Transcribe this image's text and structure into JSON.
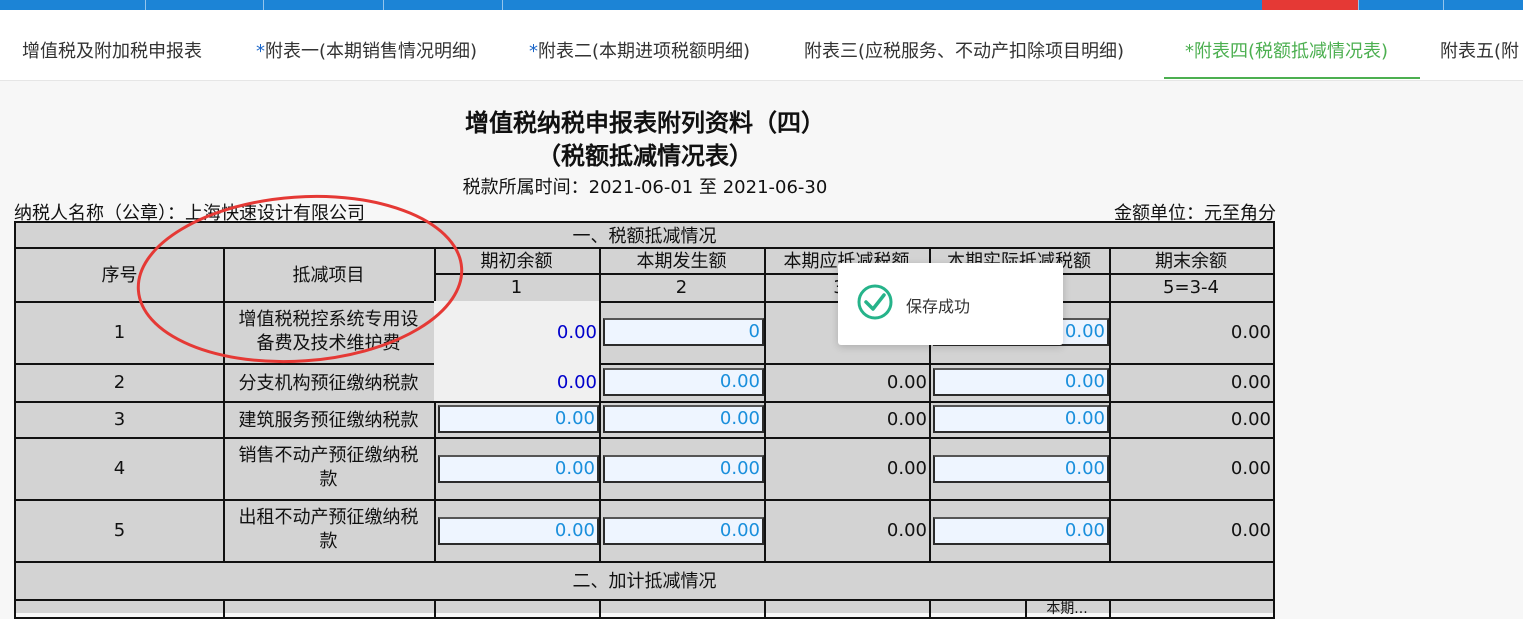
{
  "header_tabs": [
    {
      "label": "增值税及附加税申报表",
      "star": ""
    },
    {
      "label": "附表一(本期销售情况明细)",
      "star": "*"
    },
    {
      "label": "附表二(本期进项税额明细)",
      "star": "*"
    },
    {
      "label": "附表三(应税服务、不动产扣除项目明细)",
      "star": ""
    },
    {
      "label": "附表四(税额抵减情况表)",
      "star": "*"
    },
    {
      "label": "附表五(附",
      "star": ""
    }
  ],
  "form": {
    "title_line1": "增值税纳税申报表附列资料（四）",
    "title_line2": "（税额抵减情况表）",
    "period": "税款所属时间：2021-06-01 至 2021-06-30",
    "taxpayer": "纳税人名称（公章）：上海快速设计有限公司",
    "unit": "金额单位：元至角分",
    "section1": "一、税额抵减情况",
    "section2": "二、加计抵减情况",
    "col_seq": "序号",
    "col_item": "抵减项目",
    "col_begin": "期初余额",
    "col_current": "本期发生额",
    "col_deductible": "本期应抵减税额",
    "col_actual": "本期实际抵减税额",
    "col_end": "期末余额",
    "idx_begin": "1",
    "idx_current": "2",
    "idx_deductible": "3=",
    "idx_end": "5=3-4",
    "section2_partial": "本期..."
  },
  "rows": [
    {
      "seq": "1",
      "item_l1": "增值税税控系统专用设",
      "item_l2": "备费及技术维护费",
      "begin": "0.00",
      "current": "0",
      "deductible": "",
      "actual": "0.00",
      "end": "0.00"
    },
    {
      "seq": "2",
      "item_l1": "分支机构预征缴纳税款",
      "item_l2": "",
      "begin": "0.00",
      "current": "0.00",
      "deductible": "0.00",
      "actual": "0.00",
      "end": "0.00"
    },
    {
      "seq": "3",
      "item_l1": "建筑服务预征缴纳税款",
      "item_l2": "",
      "begin": "0.00",
      "current": "0.00",
      "deductible": "0.00",
      "actual": "0.00",
      "end": "0.00"
    },
    {
      "seq": "4",
      "item_l1": "销售不动产预征缴纳税",
      "item_l2": "款",
      "begin": "0.00",
      "current": "0.00",
      "deductible": "0.00",
      "actual": "0.00",
      "end": "0.00"
    },
    {
      "seq": "5",
      "item_l1": "出租不动产预征缴纳税",
      "item_l2": "款",
      "begin": "0.00",
      "current": "0.00",
      "deductible": "0.00",
      "actual": "0.00",
      "end": "0.00"
    }
  ],
  "toast": {
    "message": "保存成功"
  },
  "colors": {
    "accent": "#4caf50",
    "topbar": "#1c84d6",
    "annotation": "#e53935"
  }
}
